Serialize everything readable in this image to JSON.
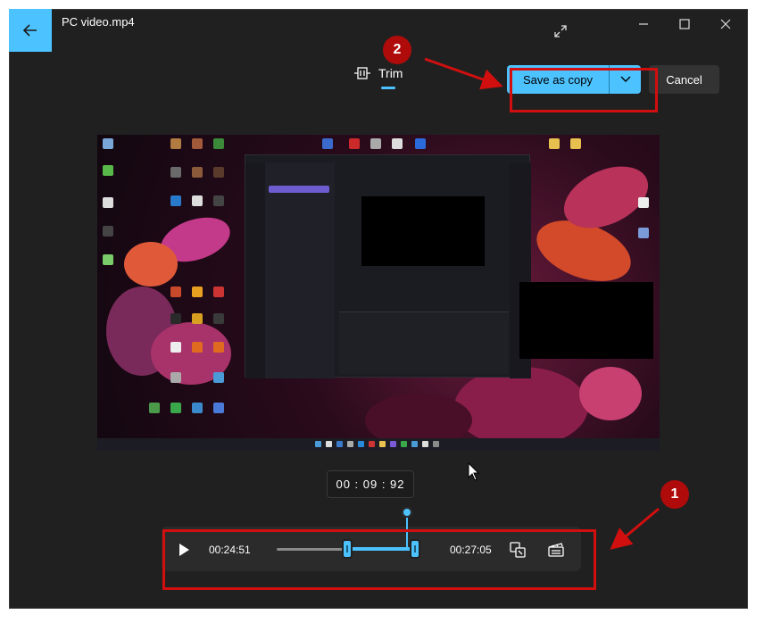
{
  "window": {
    "title": "PC video.mp4"
  },
  "titlebar": {
    "back_icon": "back-arrow-icon",
    "expand_icon": "expand-icon",
    "minimize_icon": "minimize-icon",
    "maximize_icon": "maximize-icon",
    "close_icon": "close-icon"
  },
  "toolbar": {
    "trim_label": "Trim",
    "save_label": "Save as copy",
    "cancel_label": "Cancel"
  },
  "player": {
    "current_time": "00 : 09 : 92",
    "start_time": "00:24:51",
    "end_time": "00:27:05",
    "trim_start_fraction": 0.51,
    "trim_end_fraction": 1.0
  },
  "annotations": {
    "badge_1": "1",
    "badge_2": "2"
  },
  "colors": {
    "accent": "#4cc2ff",
    "background": "#202020",
    "annotation_red": "#d10f0f"
  }
}
